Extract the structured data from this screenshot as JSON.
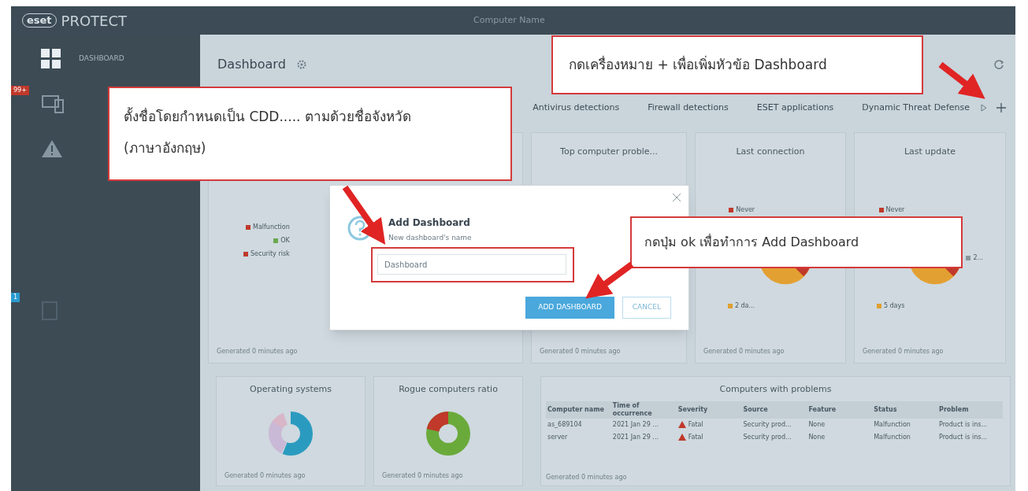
{
  "app": {
    "logo": "eset",
    "product": "PROTECT",
    "search_placeholder": "Computer Name"
  },
  "sidebar": {
    "items": [
      {
        "kind": "dashboard",
        "label": "DASHBOARD"
      },
      {
        "kind": "computers",
        "badge": "99+"
      },
      {
        "kind": "detections"
      },
      {
        "kind": "reports",
        "badge": "1"
      }
    ]
  },
  "page": {
    "title": "Dashboard"
  },
  "tabs": [
    {
      "label": "Antivirus detections"
    },
    {
      "label": "Firewall detections"
    },
    {
      "label": "ESET applications"
    },
    {
      "label": "Dynamic Threat Defense"
    }
  ],
  "cards": [
    {
      "legend": [
        {
          "label": "Malfunction",
          "color": "#c0392b"
        },
        {
          "label": "OK",
          "color": "#6aa84f"
        },
        {
          "label": "Security risk",
          "color": "#c0392b"
        }
      ],
      "footer": "Generated 0 minutes ago"
    },
    {
      "title": "Top computer proble...",
      "footer": "Generated 0 minutes ago"
    },
    {
      "title": "Last connection",
      "legend": [
        {
          "label": "Never",
          "color": "#c0392b"
        },
        {
          "label": "2 da...",
          "color": "#e0a030"
        }
      ],
      "footer": "Generated 0 minutes ago"
    },
    {
      "title": "Last update",
      "legend": [
        {
          "label": "Never",
          "color": "#c0392b"
        },
        {
          "label": "2...",
          "color": "#8a969e"
        },
        {
          "label": "5 days",
          "color": "#e0a030"
        }
      ],
      "footer": "Generated 0 minutes ago"
    }
  ],
  "bottom_cards": [
    {
      "title": "Operating systems",
      "kind": "os",
      "footer": "Generated 0 minutes ago"
    },
    {
      "title": "Rogue computers ratio",
      "kind": "rogue",
      "footer": "Generated 0 minutes ago"
    }
  ],
  "problems": {
    "title": "Computers with problems",
    "columns": [
      "Computer name",
      "Time of occurrence",
      "Severity",
      "Source",
      "Feature",
      "Status",
      "Problem"
    ],
    "rows": [
      [
        "as_689104",
        "2021 Jan 29 ...",
        "Fatal",
        "Security prod...",
        "None",
        "Malfunction",
        "Product is ins..."
      ],
      [
        "server",
        "2021 Jan 29 ...",
        "Fatal",
        "Security prod...",
        "None",
        "Malfunction",
        "Product is ins..."
      ]
    ],
    "footer": "Generated 0 minutes ago"
  },
  "dialog": {
    "title": "Add Dashboard",
    "label": "New dashboard's name",
    "value": "Dashboard",
    "buttons": [
      "ADD DASHBOARD",
      "CANCEL"
    ]
  },
  "annotations": [
    {
      "text": "ตั้งชื่อโดยกำหนดเป็น CDD..... ตามด้วยชื่อจังหวัด (ภาษาอังกฤษ)"
    },
    {
      "text": "กดเครื่องหมาย + เพื่อเพิ่มหัวข้อ Dashboard"
    },
    {
      "text": "กดปุ่ม ok เพื่อทำการ Add Dashboard"
    }
  ]
}
